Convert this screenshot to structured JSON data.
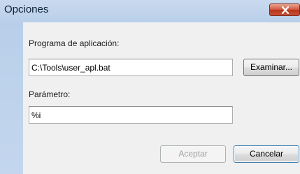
{
  "window": {
    "title": "Opciones"
  },
  "program_field": {
    "label": "Programa de aplicación:",
    "value": "C:\\Tools\\user_apl.bat"
  },
  "browse_button": {
    "label": "Examinar..."
  },
  "parameter_field": {
    "label": "Parámetro:",
    "value": "%i"
  },
  "buttons": {
    "accept": "Aceptar",
    "cancel": "Cancelar"
  },
  "icons": {
    "close": "close-icon"
  },
  "colors": {
    "close_button": "#c8503a",
    "window_frame": "#b9cfe9",
    "client_area": "#f0f0f0",
    "default_button_border": "#3c7fb1"
  }
}
